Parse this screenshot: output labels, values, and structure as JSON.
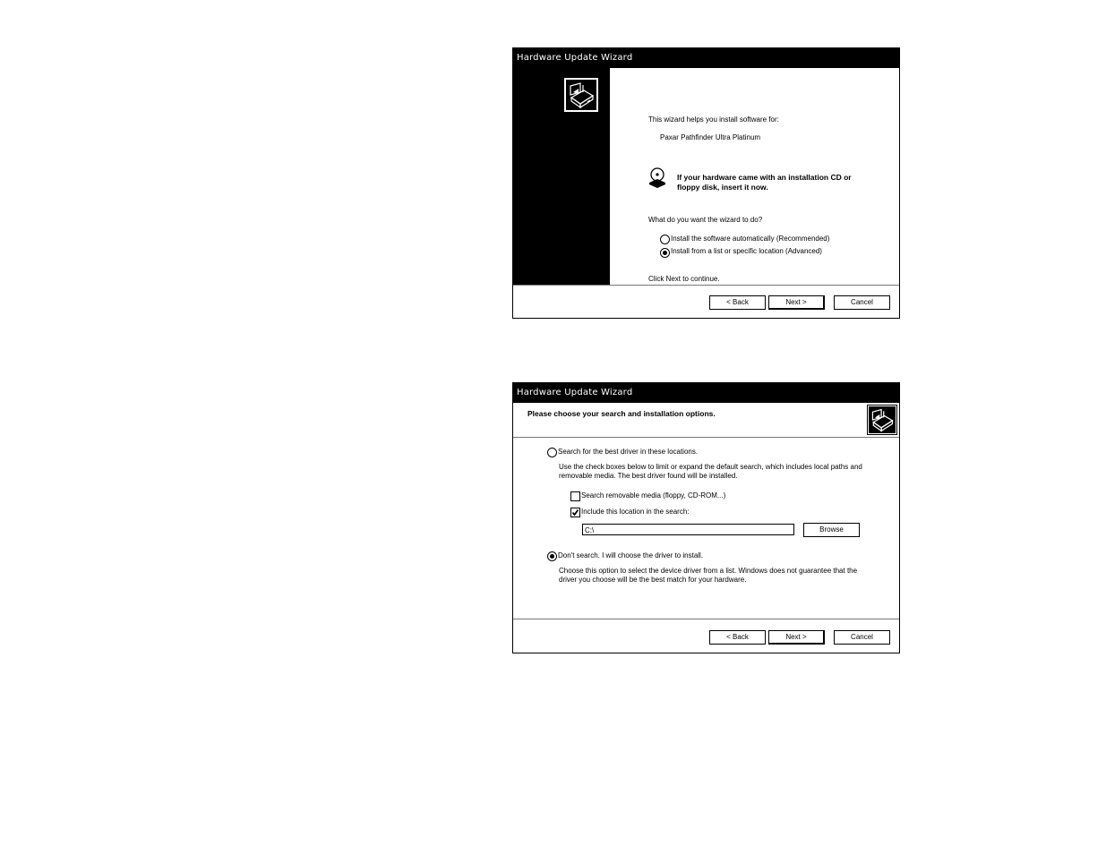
{
  "dialog1": {
    "title": "Hardware Update Wizard",
    "icon": "hardware-install-icon",
    "intro": "This wizard helps you install software for:",
    "device_name": "Paxar Pathfinder Ultra Platinum",
    "cd_icon": "cd-disk-icon",
    "cd_prompt_line1": "If your hardware came with an installation CD or",
    "cd_prompt_line2": "floppy disk, insert it now.",
    "question": "What do you want the wizard to do?",
    "options": [
      {
        "label": "Install the software automatically (Recommended)",
        "selected": false
      },
      {
        "label": "Install from a list or specific location (Advanced)",
        "selected": true
      }
    ],
    "continue_hint": "Click Next to continue.",
    "buttons": {
      "back": "< Back",
      "next": "Next >",
      "cancel": "Cancel"
    }
  },
  "dialog2": {
    "title": "Hardware Update Wizard",
    "heading": "Please choose your search and installation options.",
    "icon": "hardware-install-icon",
    "search_option": {
      "label": "Search for the best driver in these locations.",
      "selected": false,
      "description_line1": "Use the check boxes below to limit or expand the default search, which includes local paths and",
      "description_line2": "removable media. The best driver found will be installed.",
      "checkboxes": [
        {
          "label": "Search removable media (floppy, CD-ROM...)",
          "checked": false
        },
        {
          "label": "Include this location in the search:",
          "checked": true
        }
      ],
      "location_value": "C:\\",
      "browse_label": "Browse"
    },
    "manual_option": {
      "label": "Don't search. I will choose the driver to install.",
      "selected": true,
      "description_line1": "Choose this option to select the device driver from a list.  Windows does not guarantee that the",
      "description_line2": "driver you choose will be the best match for your hardware."
    },
    "buttons": {
      "back": "< Back",
      "next": "Next >",
      "cancel": "Cancel"
    }
  }
}
